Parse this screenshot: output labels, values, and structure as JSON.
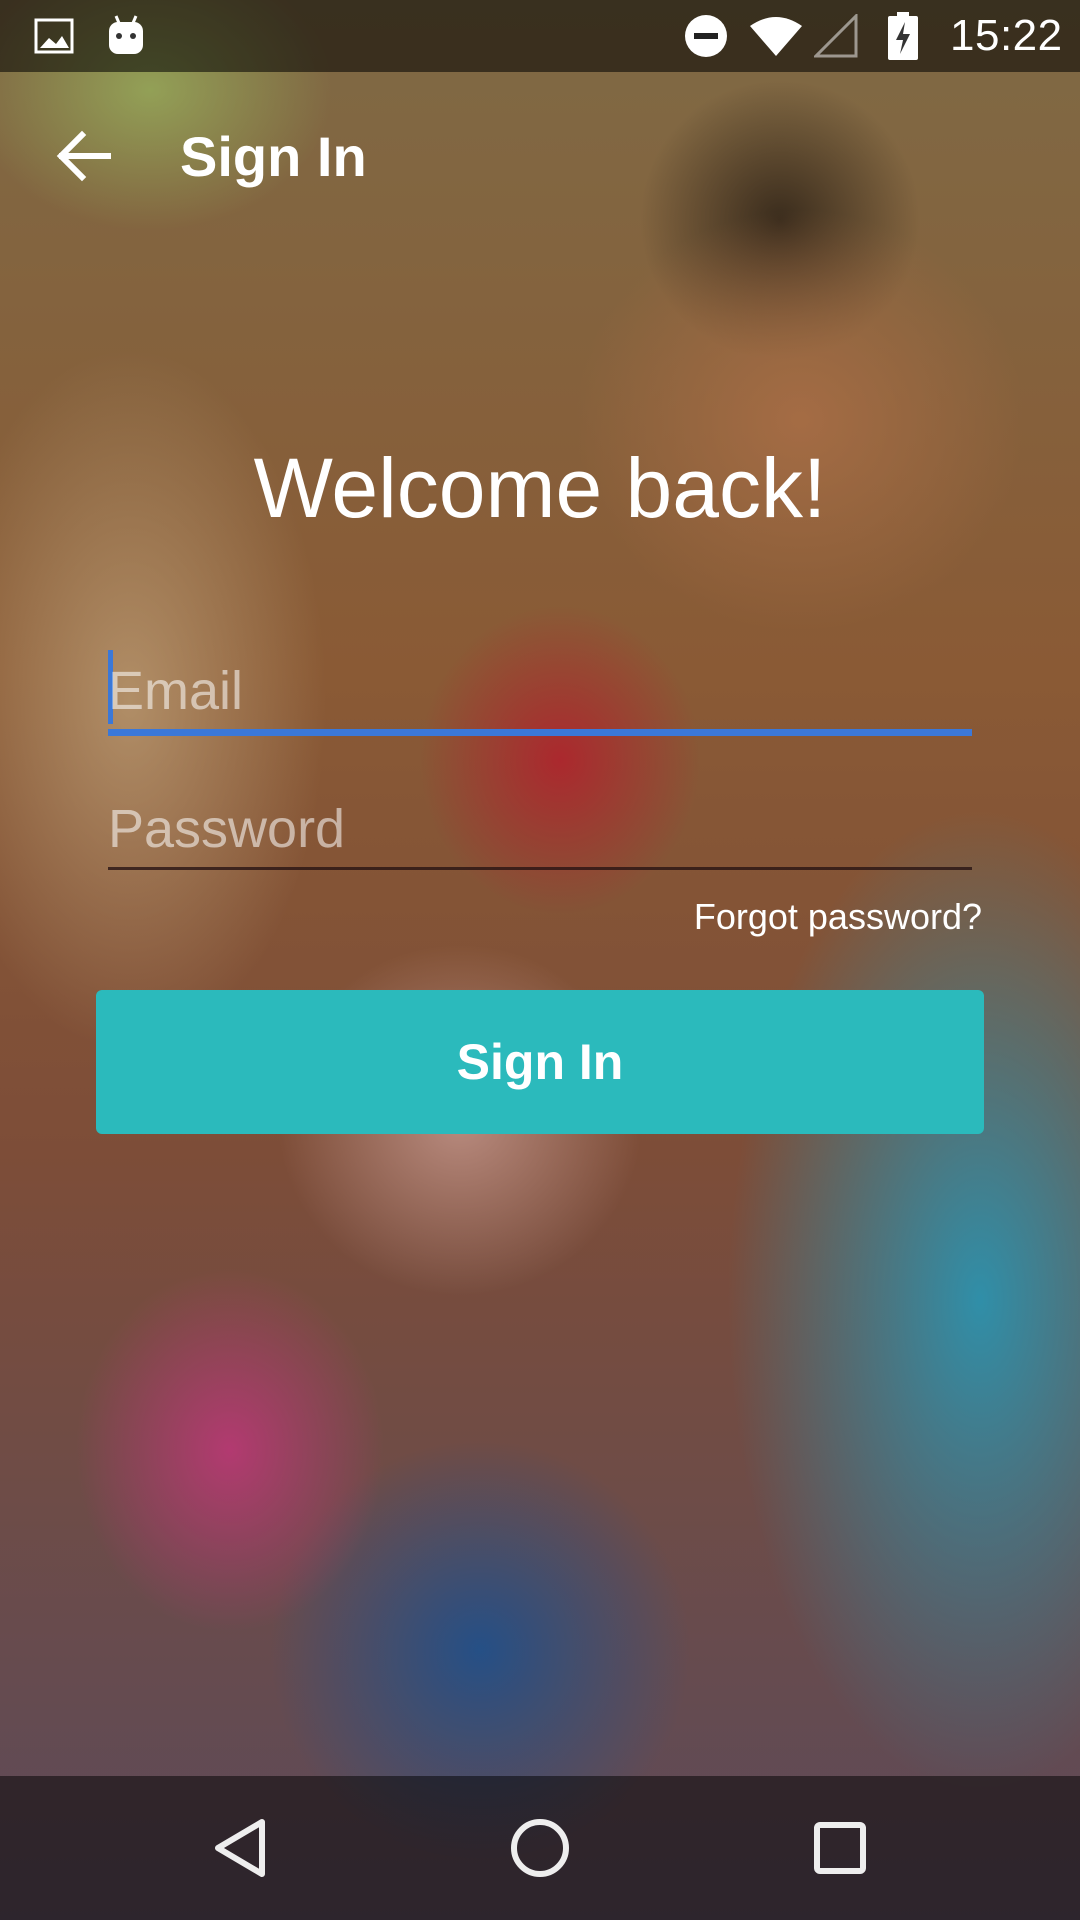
{
  "status_bar": {
    "time": "15:22",
    "icons": [
      "image-icon",
      "android-icon",
      "do-not-disturb-icon",
      "wifi-icon",
      "cellular-signal-icon",
      "battery-charging-icon"
    ]
  },
  "app_bar": {
    "title": "Sign In",
    "back_icon": "arrow-back-icon"
  },
  "main": {
    "heading": "Welcome back!",
    "email_placeholder": "Email",
    "password_placeholder": "Password",
    "forgot_link": "Forgot password?",
    "sign_in_button": "Sign In"
  },
  "nav_bar": {
    "icons": [
      "back-triangle-icon",
      "home-circle-icon",
      "recents-square-icon"
    ]
  },
  "colors": {
    "accent": "#2bbabc",
    "focus": "#3b78d8"
  }
}
